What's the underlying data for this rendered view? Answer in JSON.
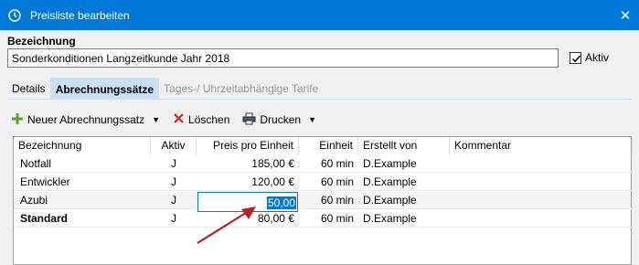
{
  "window": {
    "title": "Preisliste bearbeiten",
    "close": "✕"
  },
  "form": {
    "bezeichnung_label": "Bezeichnung",
    "bezeichnung_value": "Sonderkonditionen Langzeitkunde Jahr 2018",
    "aktiv_label": "Aktiv",
    "aktiv_checked": true
  },
  "tabs": [
    {
      "label": "Details"
    },
    {
      "label": "Abrechnungssätze"
    },
    {
      "label": "Tages-/ Uhrzeitabhängige Tarife"
    }
  ],
  "toolbar": {
    "new_label": "Neuer Abrechnungssatz",
    "delete_label": "Löschen",
    "print_label": "Drucken"
  },
  "grid": {
    "columns": [
      "Bezeichnung",
      "Aktiv",
      "Preis pro Einheit",
      "Einheit",
      "Erstellt von",
      "Kommentar"
    ],
    "rows": [
      {
        "bezeichnung": "Notfall",
        "aktiv": "J",
        "preis": "185,00 €",
        "einheit": "60 min",
        "erstellt": "D.Example",
        "kommentar": ""
      },
      {
        "bezeichnung": "Entwickler",
        "aktiv": "J",
        "preis": "120,00 €",
        "einheit": "60 min",
        "erstellt": "D.Example",
        "kommentar": ""
      },
      {
        "bezeichnung": "Azubi",
        "aktiv": "J",
        "preis": "50,00",
        "einheit": "60 min",
        "erstellt": "D.Example",
        "kommentar": ""
      },
      {
        "bezeichnung": "Standard",
        "aktiv": "J",
        "preis": "80,00 €",
        "einheit": "60 min",
        "erstellt": "D.Example",
        "kommentar": ""
      }
    ]
  },
  "colors": {
    "accent": "#0078d7",
    "tab_active": "#c9e0f7",
    "arrow": "#b22222"
  }
}
